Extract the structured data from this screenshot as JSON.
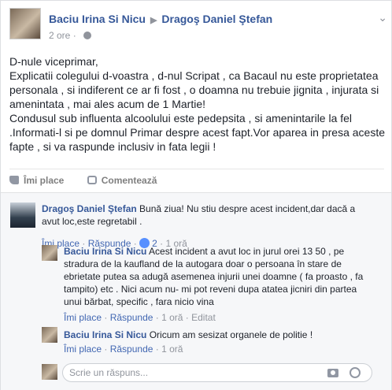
{
  "post": {
    "author": "Baciu Irina Si Nicu",
    "target": "Dragoş Daniel Ştefan",
    "time": "2 ore",
    "paragraphs": [
      "D-nule viceprimar,",
      "Explicatii colegului d-voastra , d-nul Scripat , ca Bacaul nu este proprietatea personala , si indiferent ce ar fi fost , o doamna nu trebuie jignita , injurata si amenintata , mai ales acum de 1 Martie!",
      "Condusul sub influenta alcoolului este pedepsita , si amenintarile la fel .Informati-l si pe domnul Primar despre acest fapt.Vor aparea in presa aceste fapte , si va raspunde inclusiv in fata legii !"
    ],
    "actions": {
      "like": "Îmi place",
      "comment": "Comentează"
    }
  },
  "comments": [
    {
      "name": "Dragoş Daniel Ştefan",
      "text": "Bună ziua! Nu stiu despre acest incident,dar dacă a avut loc,este regretabil .",
      "like": "Îmi place",
      "reply": "Răspunde",
      "reactions": "2",
      "time": "1 oră"
    },
    {
      "name": "Baciu Irina Si Nicu",
      "text": "Acest incident a avut loc in jurul orei 13 50 , pe stradura de la kaufland de la autogara doar o persoana în stare de ebrietate putea sa adugă asemenea injurii unei doamne ( fa proasto , fa tampito) etc . Nici acum nu- mi pot reveni dupa atatea jicniri din partea unui bărbat, specific , fara nicio vina",
      "like": "Îmi place",
      "reply": "Răspunde",
      "time": "1 oră",
      "edited": "Editat"
    },
    {
      "name": "Baciu Irina Si Nicu",
      "text": "Oricum am sesizat organele de politie !",
      "like": "Îmi place",
      "reply": "Răspunde",
      "time": "1 oră"
    }
  ],
  "reply_box": {
    "placeholder": "Scrie un răspuns..."
  }
}
